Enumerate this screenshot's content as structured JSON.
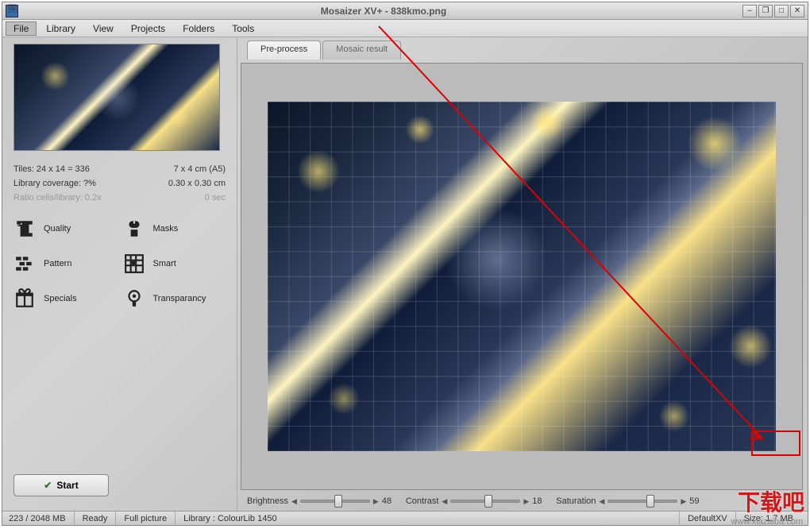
{
  "title": "Mosaizer XV+  - 838kmo.png",
  "menubar": [
    "File",
    "Library",
    "View",
    "Projects",
    "Folders",
    "Tools"
  ],
  "activeMenu": "File",
  "info": {
    "tiles_label": "Tiles: 24 x 14 = 336",
    "tiles_value": "7 x 4 cm (A5)",
    "coverage_label": "Library coverage: ?%",
    "coverage_value": "0.30 x 0.30 cm",
    "ratio_label": "Ratio cells/library: 0.2x",
    "ratio_value": "0 sec"
  },
  "options": {
    "quality": "Quality",
    "masks": "Masks",
    "pattern": "Pattern",
    "smart": "Smart",
    "specials": "Specials",
    "transparency": "Transparancy"
  },
  "start_label": "Start",
  "tabs": {
    "preprocess": "Pre-process",
    "mosaic": "Mosaic result"
  },
  "sliders": {
    "brightness": {
      "label": "Brightness",
      "value": "48",
      "pos": 48
    },
    "contrast": {
      "label": "Contrast",
      "value": "18",
      "pos": 48
    },
    "saturation": {
      "label": "Saturation",
      "value": "59",
      "pos": 55
    }
  },
  "status": {
    "mem": "223 / 2048 MB",
    "state": "Ready",
    "mode": "Full picture",
    "library": "Library   : ColourLib 1450",
    "xv": "DefaultXV",
    "size": "Size: 1.7 MB"
  },
  "watermark": {
    "text": "下载吧",
    "url": "www.xiazaiba.com"
  }
}
